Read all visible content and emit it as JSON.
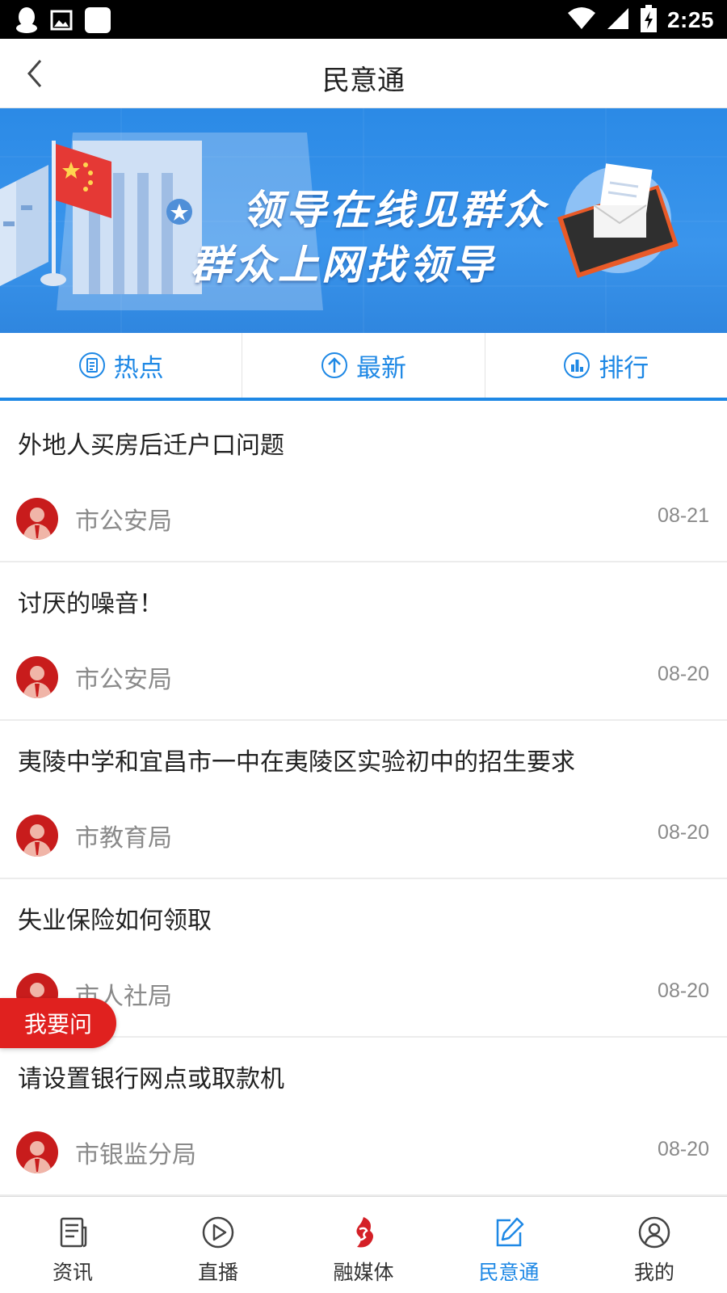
{
  "status_bar": {
    "time": "2:25",
    "left_icons": [
      "qq-icon",
      "image-icon",
      "app-icon"
    ],
    "right_icons": [
      "wifi-icon",
      "signal-icon",
      "battery-charging-icon"
    ]
  },
  "header": {
    "title": "民意通",
    "back_icon": "chevron-left-icon"
  },
  "banner": {
    "line1": "领导在线见群众",
    "line2": "群众上网找领导"
  },
  "tabs": [
    {
      "label": "热点",
      "icon": "document-icon",
      "active": true
    },
    {
      "label": "最新",
      "icon": "arrow-up-circle-icon",
      "active": false
    },
    {
      "label": "排行",
      "icon": "bar-chart-circle-icon",
      "active": false
    }
  ],
  "list": [
    {
      "title": "外地人买房后迁户口问题",
      "dept": "市公安局",
      "date": "08-21"
    },
    {
      "title": "讨厌的噪音！",
      "dept": "市公安局",
      "date": "08-20"
    },
    {
      "title": "夷陵中学和宜昌市一中在夷陵区实验初中的招生要求",
      "dept": "市教育局",
      "date": "08-20"
    },
    {
      "title": "失业保险如何领取",
      "dept": "市人社局",
      "date": "08-20"
    },
    {
      "title": "请设置银行网点或取款机",
      "dept": "市银监分局",
      "date": "08-20"
    }
  ],
  "ask_button": {
    "label": "我要问"
  },
  "bottom_nav": [
    {
      "label": "资讯",
      "icon": "news-icon",
      "active": false
    },
    {
      "label": "直播",
      "icon": "play-circle-icon",
      "active": false
    },
    {
      "label": "融媒体",
      "icon": "media-logo-icon",
      "active": false
    },
    {
      "label": "民意通",
      "icon": "edit-icon",
      "active": true
    },
    {
      "label": "我的",
      "icon": "user-circle-icon",
      "active": false
    }
  ],
  "colors": {
    "accent": "#1e88e5",
    "ask_red": "#e0211f",
    "avatar_red": "#c81c1c"
  }
}
